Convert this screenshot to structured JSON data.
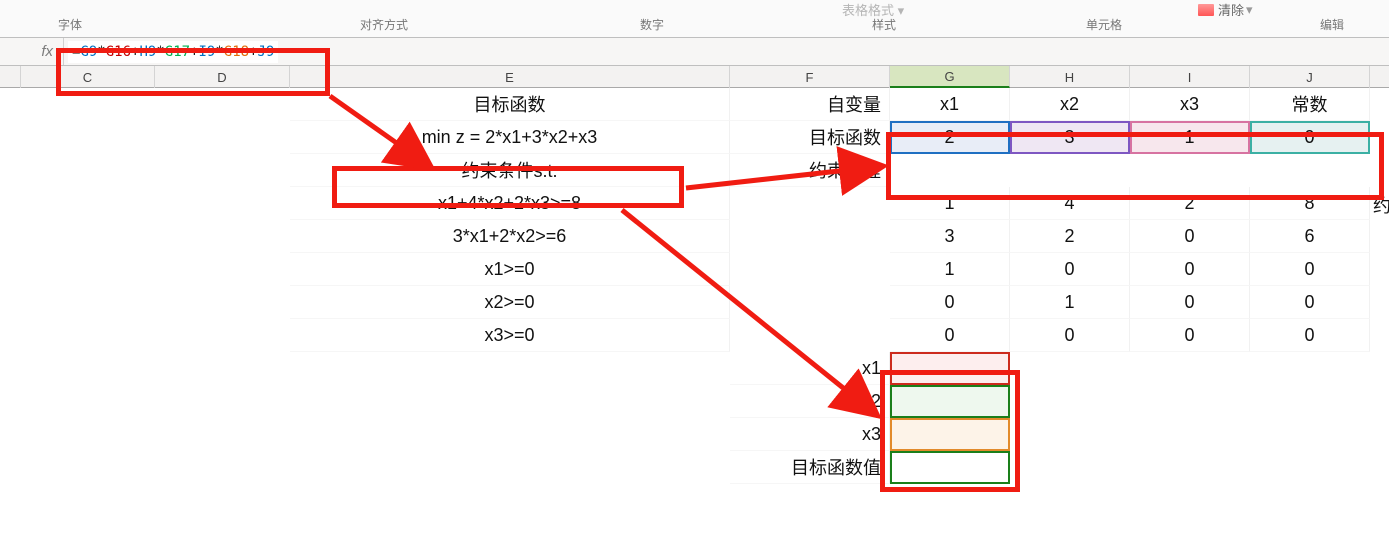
{
  "ribbon": {
    "groups": {
      "font": "字体",
      "alignment": "对齐方式",
      "number": "数字",
      "styles": "样式",
      "cells": "单元格",
      "editing": "编辑"
    },
    "table_format_label": "表格格式",
    "clear_label": "清除"
  },
  "formula_bar": {
    "fx": "fx",
    "parts": [
      {
        "cls": "t-black",
        "text": "="
      },
      {
        "cls": "t-blue",
        "text": "G9"
      },
      {
        "cls": "t-black",
        "text": "*"
      },
      {
        "cls": "t-red",
        "text": "G16"
      },
      {
        "cls": "t-black",
        "text": "+"
      },
      {
        "cls": "t-blue",
        "text": "H9"
      },
      {
        "cls": "t-black",
        "text": "*"
      },
      {
        "cls": "t-green",
        "text": "G17"
      },
      {
        "cls": "t-black",
        "text": "+"
      },
      {
        "cls": "t-blue",
        "text": "I9"
      },
      {
        "cls": "t-black",
        "text": "*"
      },
      {
        "cls": "t-orange",
        "text": "G18"
      },
      {
        "cls": "t-black",
        "text": "+"
      },
      {
        "cls": "t-blue",
        "text": "J9"
      }
    ],
    "full_text": "=G9*G16+H9*G17+I9*G18+J9"
  },
  "columns": [
    "C",
    "D",
    "E",
    "F",
    "G",
    "H",
    "I",
    "J"
  ],
  "sheet": {
    "E": {
      "r1": "目标函数",
      "r2": "min z = 2*x1+3*x2+x3",
      "r3": "约束条件s.t.",
      "r4": "x1+4*x2+2*x3>=8",
      "r5": "3*x1+2*x2>=6",
      "r6": "x1>=0",
      "r7": "x2>=0",
      "r8": "x3>=0"
    },
    "F": {
      "r1": "自变量",
      "r2": "目标函数",
      "r3": "约束方程",
      "r9": "x1",
      "r10": "x2",
      "r11": "x3",
      "r12": "目标函数值"
    },
    "G": {
      "r1": "x1",
      "r2": "2",
      "r4": "1",
      "r5": "3",
      "r6": "1",
      "r7": "0",
      "r8": "0"
    },
    "H": {
      "r1": "x2",
      "r2": "3",
      "r4": "4",
      "r5": "2",
      "r6": "0",
      "r7": "1",
      "r8": "0"
    },
    "I": {
      "r1": "x3",
      "r2": "1",
      "r4": "2",
      "r5": "0",
      "r6": "0",
      "r7": "0",
      "r8": "0"
    },
    "J": {
      "r1": "常数",
      "r2": "0",
      "r4": "8",
      "r5": "6",
      "r6": "0",
      "r7": "0",
      "r8": "0"
    },
    "K_partial": "约"
  }
}
